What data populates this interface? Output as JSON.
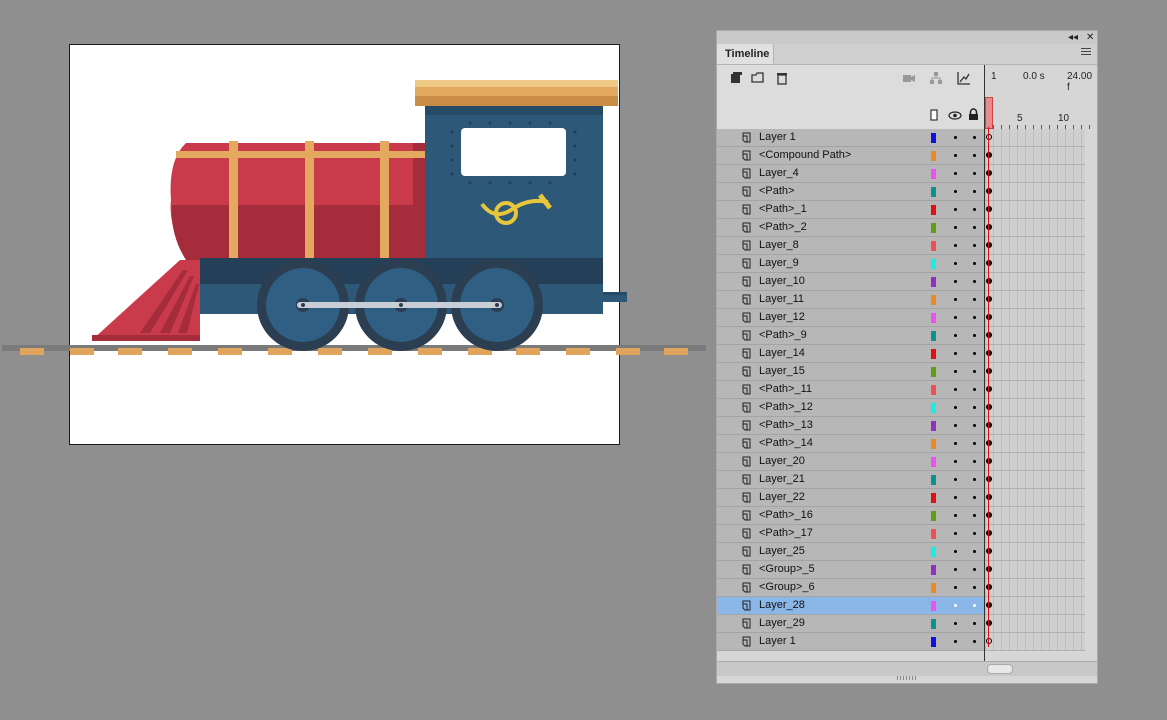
{
  "panel": {
    "tab_label": "Timeline",
    "collapse_glyph": "◂◂",
    "close_glyph": "✕",
    "ruler": {
      "frame_label": "1",
      "time_label": "0.0 s",
      "fps_label": "24.00 f",
      "tick_1": "1",
      "tick_5": "5",
      "tick_10": "10"
    }
  },
  "layers": [
    {
      "name": "Layer 1",
      "color": "#1010e0"
    },
    {
      "name": "<Compound Path>",
      "color": "#f08a1c"
    },
    {
      "name": "Layer_4",
      "color": "#f050f0"
    },
    {
      "name": "<Path>",
      "color": "#109090"
    },
    {
      "name": "<Path>_1",
      "color": "#e01010"
    },
    {
      "name": "<Path>_2",
      "color": "#5aa010"
    },
    {
      "name": "Layer_8",
      "color": "#f05050"
    },
    {
      "name": "Layer_9",
      "color": "#10f0f0"
    },
    {
      "name": "Layer_10",
      "color": "#9030c0"
    },
    {
      "name": "Layer_11",
      "color": "#f08a1c"
    },
    {
      "name": "Layer_12",
      "color": "#f050f0"
    },
    {
      "name": "<Path>_9",
      "color": "#109090"
    },
    {
      "name": "Layer_14",
      "color": "#e01010"
    },
    {
      "name": "Layer_15",
      "color": "#5aa010"
    },
    {
      "name": "<Path>_11",
      "color": "#f05050"
    },
    {
      "name": "<Path>_12",
      "color": "#10f0f0"
    },
    {
      "name": "<Path>_13",
      "color": "#9030c0"
    },
    {
      "name": "<Path>_14",
      "color": "#f08a1c"
    },
    {
      "name": "Layer_20",
      "color": "#f050f0"
    },
    {
      "name": "Layer_21",
      "color": "#109090"
    },
    {
      "name": "Layer_22",
      "color": "#e01010"
    },
    {
      "name": "<Path>_16",
      "color": "#5aa010"
    },
    {
      "name": "<Path>_17",
      "color": "#f05050"
    },
    {
      "name": "Layer_25",
      "color": "#10f0f0"
    },
    {
      "name": "<Group>_5",
      "color": "#9030c0"
    },
    {
      "name": "<Group>_6",
      "color": "#f08a1c"
    },
    {
      "name": "Layer_28",
      "color": "#f050f0",
      "selected": true
    },
    {
      "name": "Layer_29",
      "color": "#109090"
    },
    {
      "name": "Layer 1",
      "color": "#1010e0"
    }
  ],
  "colors": {
    "tank_red": "#c93a4a",
    "tank_dark": "#a52c3b",
    "cab_blue": "#2e5878",
    "band_tan": "#e3a95f",
    "horn_gold": "#e6c63a",
    "wheel_rim": "#2b3e52",
    "wheel_face": "#2f5f82",
    "rail_grey": "#7a7a7a",
    "tie_tan": "#e0a45c"
  }
}
